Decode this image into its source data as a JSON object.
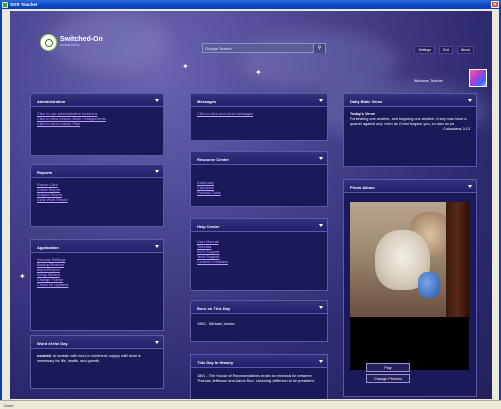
{
  "window": {
    "title": "SOS Teacher",
    "status_text": "Done"
  },
  "header": {
    "logo_name": "Switched-On",
    "logo_tagline": "SCHOOLHOUSE",
    "search_placeholder": "Google Search",
    "links": [
      "Settings",
      "Exit",
      "About"
    ],
    "welcome": "Welcome, Teacher"
  },
  "panels": {
    "administration": {
      "title": "Administration",
      "links": [
        "Click to use administrative functions",
        "Click to view Lesson Book / Assignments",
        "Click to view Lesson Plan"
      ]
    },
    "reports": {
      "title": "Reports",
      "links": [
        "Report Card",
        "Grade Report",
        "Subject Report",
        "Daily Work Report"
      ]
    },
    "application": {
      "title": "Application",
      "links": [
        "Security Settings",
        "Backup/Restore",
        "Import/Export",
        "Setup Wizard",
        "Change Theme",
        "Check for Updates"
      ]
    },
    "word_of_day": {
      "title": "Word of the Day",
      "word": "nourish",
      "definition": "to sustain with food or nutriment; supply with what is necessary for life, health, and growth."
    },
    "messages": {
      "title": "Messages",
      "link": "Click to view and send messages"
    },
    "resource_center": {
      "title": "Resource Center",
      "links": [
        "Dictionary",
        "Calculator",
        "Periodic Table"
      ]
    },
    "help_center": {
      "title": "Help Center",
      "links": [
        "User Manual",
        "Tutorials",
        "SOS Support",
        "Tech Support",
        "Content Feedback"
      ]
    },
    "born_on_day": {
      "title": "Born on This Day",
      "text": "1963 - Michael Jordan"
    },
    "history": {
      "title": "This Day In History",
      "text": "1801 - The House of Representatives broke an electoral tie between Thomas Jefferson and Aaron Burr, choosing Jefferson to be president."
    },
    "bible_verse": {
      "title": "Daily Bible Verse",
      "heading": "Today's Verse",
      "text": "Forbearing one another, and forgiving one another, if any man have a quarrel against any: even as Christ forgave you, so also do ye.",
      "reference": "Colossians 3:13"
    },
    "photo_album": {
      "title": "Photo Album",
      "play_label": "Play",
      "change_label": "Change Pictures"
    }
  }
}
